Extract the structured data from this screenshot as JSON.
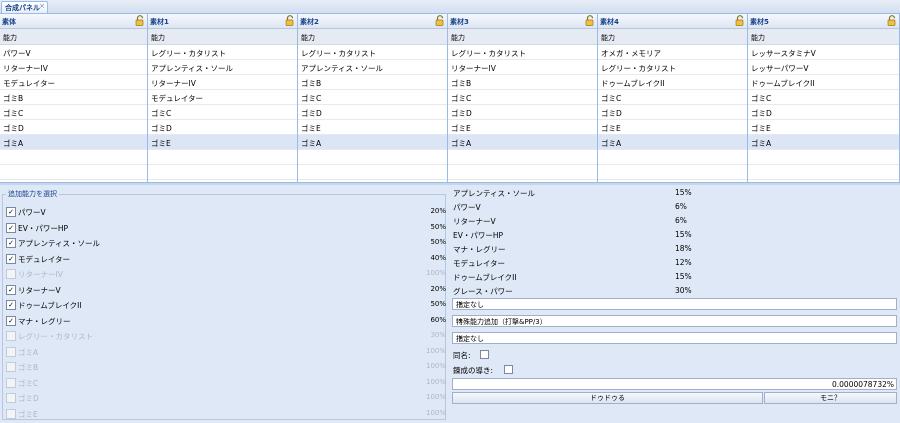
{
  "tab": {
    "label": "合成パネル",
    "close": "×"
  },
  "grid": {
    "columns": [
      {
        "title": "素体",
        "header": "能力",
        "rows": [
          "パワーV",
          "リターナーIV",
          "モデュレイター",
          "ゴミB",
          "ゴミC",
          "ゴミD",
          "ゴミA"
        ]
      },
      {
        "title": "素材1",
        "header": "能力",
        "rows": [
          "レグリー・カタリスト",
          "アプレンティス・ソール",
          "リターナーIV",
          "モデュレイター",
          "ゴミC",
          "ゴミD",
          "ゴミE"
        ]
      },
      {
        "title": "素材2",
        "header": "能力",
        "rows": [
          "レグリー・カタリスト",
          "アプレンティス・ソール",
          "ゴミB",
          "ゴミC",
          "ゴミD",
          "ゴミE",
          "ゴミA"
        ]
      },
      {
        "title": "素材3",
        "header": "能力",
        "rows": [
          "レグリー・カタリスト",
          "リターナーIV",
          "ゴミB",
          "ゴミC",
          "ゴミD",
          "ゴミE",
          "ゴミA"
        ]
      },
      {
        "title": "素材4",
        "header": "能力",
        "rows": [
          "オメガ・メモリア",
          "レグリー・カタリスト",
          "ドゥームブレイクII",
          "ゴミC",
          "ゴミD",
          "ゴミE",
          "ゴミA"
        ]
      },
      {
        "title": "素材5",
        "header": "能力",
        "rows": [
          "レッサースタミナV",
          "レッサーパワーV",
          "ドゥームブレイクII",
          "ゴミC",
          "ゴミD",
          "ゴミE",
          "ゴミA"
        ]
      }
    ]
  },
  "abilities": {
    "legend": "追加能力を選択",
    "items": [
      {
        "name": "パワーV",
        "pct": "20%",
        "checked": true,
        "enabled": true
      },
      {
        "name": "EV・パワーHP",
        "pct": "50%",
        "checked": true,
        "enabled": true
      },
      {
        "name": "アプレンティス・ソール",
        "pct": "50%",
        "checked": true,
        "enabled": true
      },
      {
        "name": "モデュレイター",
        "pct": "40%",
        "checked": true,
        "enabled": true
      },
      {
        "name": "リターナーIV",
        "pct": "100%",
        "checked": false,
        "enabled": false
      },
      {
        "name": "リターナーV",
        "pct": "20%",
        "checked": true,
        "enabled": true
      },
      {
        "name": "ドゥームブレイクII",
        "pct": "50%",
        "checked": true,
        "enabled": true
      },
      {
        "name": "マナ・レグリー",
        "pct": "60%",
        "checked": true,
        "enabled": true
      },
      {
        "name": "レグリー・カタリスト",
        "pct": "30%",
        "checked": false,
        "enabled": false
      },
      {
        "name": "ゴミA",
        "pct": "100%",
        "checked": false,
        "enabled": false
      },
      {
        "name": "ゴミB",
        "pct": "100%",
        "checked": false,
        "enabled": false
      },
      {
        "name": "ゴミC",
        "pct": "100%",
        "checked": false,
        "enabled": false
      },
      {
        "name": "ゴミD",
        "pct": "100%",
        "checked": false,
        "enabled": false
      },
      {
        "name": "ゴミE",
        "pct": "100%",
        "checked": false,
        "enabled": false
      }
    ]
  },
  "results": [
    {
      "name": "アプレンティス・ソール",
      "pct": "15%"
    },
    {
      "name": "パワーV",
      "pct": "6%"
    },
    {
      "name": "リターナーV",
      "pct": "6%"
    },
    {
      "name": "EV・パワーHP",
      "pct": "15%"
    },
    {
      "name": "マナ・レグリー",
      "pct": "18%"
    },
    {
      "name": "モデュレイター",
      "pct": "12%"
    },
    {
      "name": "ドゥームブレイクII",
      "pct": "15%"
    },
    {
      "name": "グレース・パワー",
      "pct": "30%"
    }
  ],
  "selects": [
    "指定なし",
    "特殊能力追加（打撃&PP/3）",
    "指定なし"
  ],
  "same_name_label": "同名:",
  "refine_label": "錬成の導き:",
  "probability": "0.0000078732%",
  "buttons": {
    "doodle": "ドゥドゥる",
    "moni": "モニ？"
  }
}
